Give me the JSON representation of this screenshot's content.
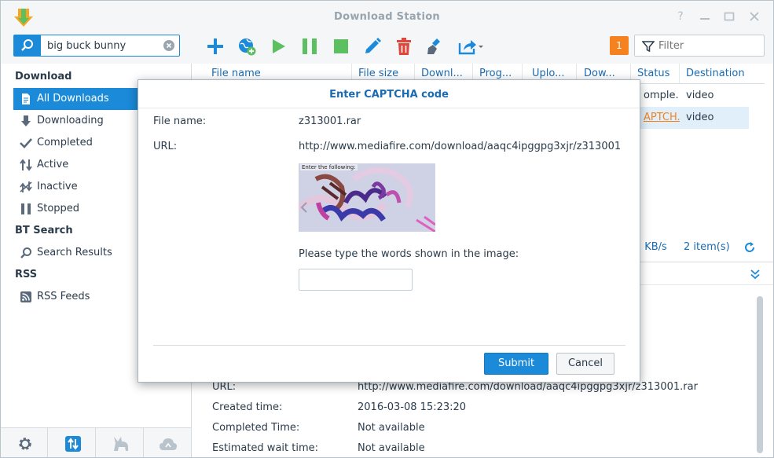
{
  "window": {
    "title": "Download Station"
  },
  "search": {
    "value": "big buck bunny"
  },
  "toolbar": {
    "icons": [
      "add-icon",
      "add-url-icon",
      "resume-icon",
      "pause-icon",
      "stop-icon",
      "edit-icon",
      "delete-icon",
      "clear-completed-icon",
      "share-icon"
    ],
    "notification_count": "1",
    "filter_placeholder": "Filter"
  },
  "sidebar": {
    "download_header": "Download",
    "download_items": [
      {
        "label": "All Downloads",
        "icon": "document-icon",
        "active": true
      },
      {
        "label": "Downloading",
        "icon": "arrow-down-icon"
      },
      {
        "label": "Completed",
        "icon": "checkmark-icon"
      },
      {
        "label": "Active",
        "icon": "up-down-arrows-icon"
      },
      {
        "label": "Inactive",
        "icon": "inactive-icon"
      },
      {
        "label": "Stopped",
        "icon": "pause-icon"
      }
    ],
    "bt_header": "BT Search",
    "bt_items": [
      {
        "label": "Search Results",
        "icon": "search-icon"
      }
    ],
    "rss_header": "RSS",
    "rss_items": [
      {
        "label": "RSS Feeds",
        "icon": "rss-icon"
      }
    ]
  },
  "grid": {
    "columns": [
      "File name",
      "File size",
      "Downl...",
      "Prog...",
      "Uplo...",
      "Dow...",
      "Status",
      "Destination"
    ],
    "rows": [
      {
        "status": "omple...",
        "destination": "video"
      },
      {
        "status": "APTCH...",
        "destination": "video"
      }
    ],
    "speed": ") KB/s",
    "item_count": "2 item(s)"
  },
  "details": [
    {
      "label": "URL:",
      "value": "http://www.mediafire.com/download/aaqc4ipggpg3xjr/z313001.rar"
    },
    {
      "label": "Created time:",
      "value": "2016-03-08 15:23:20"
    },
    {
      "label": "Completed Time:",
      "value": "Not available"
    },
    {
      "label": "Estimated wait time:",
      "value": "Not available"
    }
  ],
  "dialog": {
    "title": "Enter CAPTCHA code",
    "file_name_label": "File name:",
    "file_name_value": "z313001.rar",
    "url_label": "URL:",
    "url_value": "http://www.mediafire.com/download/aaqc4ipggpg3xjr/z313001....",
    "captcha_hint": "Enter the following:",
    "prompt": "Please type the words shown in the image:",
    "input_value": "",
    "submit_label": "Submit",
    "cancel_label": "Cancel"
  },
  "colors": {
    "accent": "#1b8ad8",
    "orange": "#f5821f",
    "green": "#5cc061",
    "red": "#e0473a"
  }
}
